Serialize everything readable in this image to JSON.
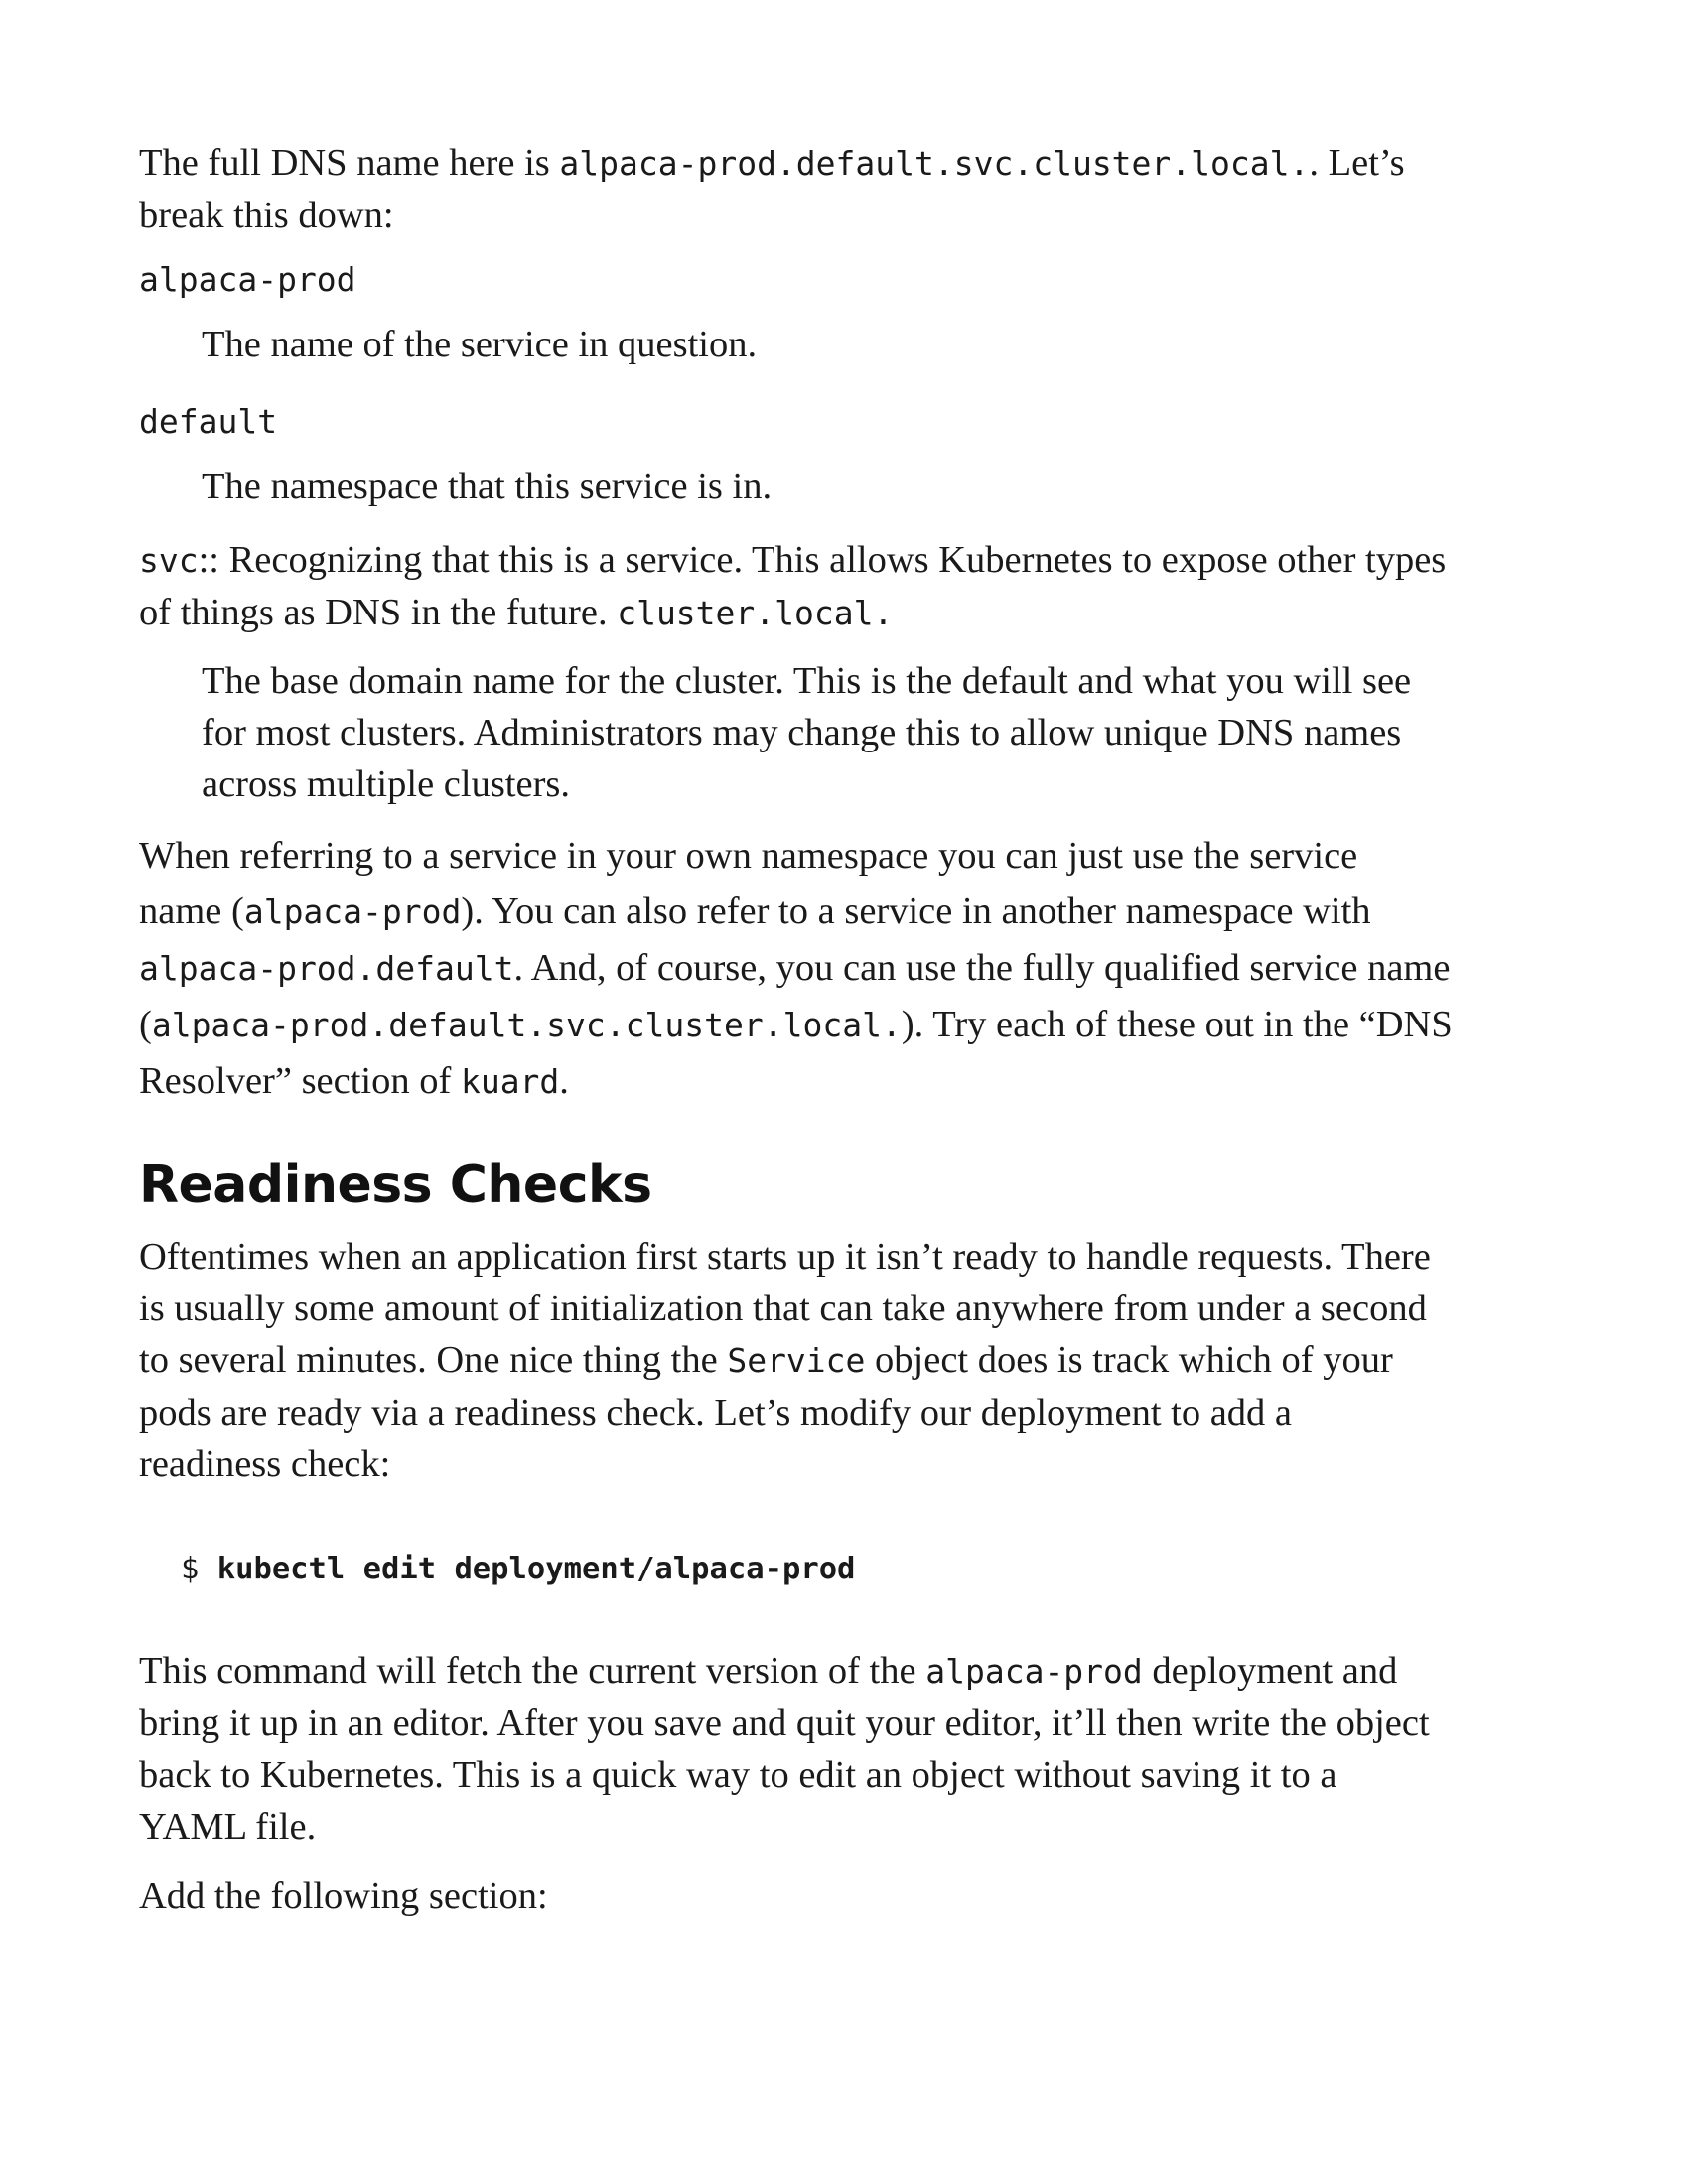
{
  "intro": {
    "t1": "The full DNS name here is ",
    "c1": "alpaca-prod.default.svc.cluster.local.",
    "t2": ". Let’s",
    "t3": "break this down:"
  },
  "defs": [
    {
      "term": "alpaca-prod",
      "desc": "The name of the service in question."
    },
    {
      "term": "default",
      "desc": "The namespace that this service is in."
    }
  ],
  "svc_para": {
    "c1": "svc",
    "t1": ":: Recognizing that this is a service. This allows Kubernetes to expose other types",
    "t2": "of things as DNS in the future. ",
    "c2": "cluster.local."
  },
  "cluster_def": {
    "l1": "The base domain name for the cluster. This is the default and what you will see",
    "l2": "for most clusters. Administrators may change this to allow unique DNS names",
    "l3": "across multiple clusters."
  },
  "referring": {
    "l1": "When referring to a service in your own namespace you can just use the service",
    "l2a": "name (",
    "l2c": "alpaca-prod",
    "l2b": "). You can also refer to a service in another namespace with",
    "l3c": "alpaca-prod.default",
    "l3b": ". And, of course, you can use the fully qualified service name",
    "l4a": "(",
    "l4c": "alpaca-prod.default.svc.cluster.local.",
    "l4b": "). Try each of these out in the “DNS",
    "l5a": "Resolver” section of ",
    "l5c": "kuard",
    "l5b": "."
  },
  "heading": "Readiness Checks",
  "readiness": {
    "l1": "Oftentimes when an application first starts up it isn’t ready to handle requests. There",
    "l2": "is usually some amount of initialization that can take anywhere from under a second",
    "l3a": "to several minutes. One nice thing the ",
    "l3c": "Service",
    "l3b": " object does is track which of your",
    "l4": "pods are ready via a readiness check. Let’s modify our deployment to add a",
    "l5": "readiness check:"
  },
  "command": {
    "prompt": "$ ",
    "cmd": "kubectl edit deployment/alpaca-prod"
  },
  "after": {
    "l1a": "This command will fetch the current version of the ",
    "l1c": "alpaca-prod",
    "l1b": " deployment and",
    "l2": "bring it up in an editor. After you save and quit your editor, it’ll then write the object",
    "l3": "back to Kubernetes. This is a quick way to edit an object without saving it to a",
    "l4": "YAML file."
  },
  "add_section": "Add the following section:"
}
